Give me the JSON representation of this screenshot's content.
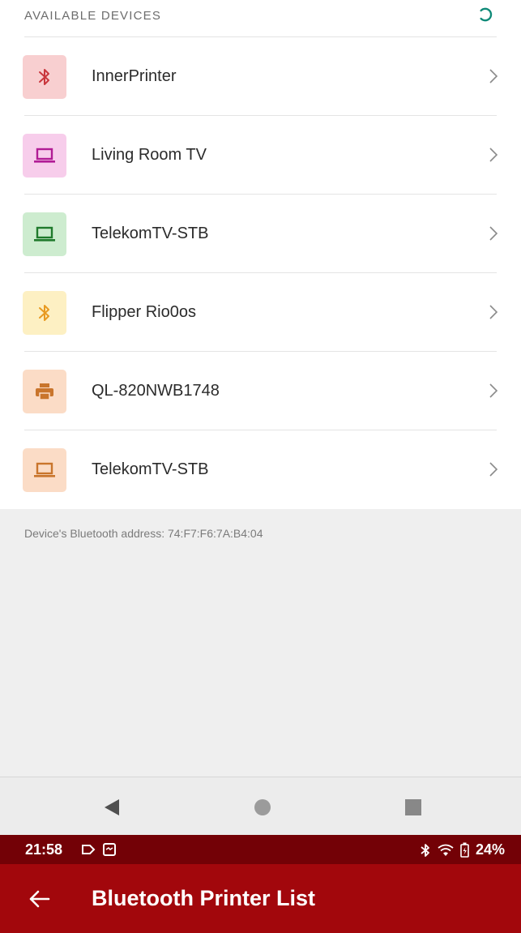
{
  "section": {
    "title": "AVAILABLE DEVICES"
  },
  "devices": [
    {
      "name": "InnerPrinter",
      "icon": "bluetooth-icon",
      "tile_color": "#f8cfd0",
      "icon_color": "#c9373d"
    },
    {
      "name": "Living Room TV",
      "icon": "laptop-icon",
      "tile_color": "#f7cdeb",
      "icon_color": "#b11c95"
    },
    {
      "name": "TelekomTV-STB",
      "icon": "laptop-icon",
      "tile_color": "#cdeccf",
      "icon_color": "#1f7a2c"
    },
    {
      "name": "Flipper Rio0os",
      "icon": "bluetooth-icon",
      "tile_color": "#fdf0c3",
      "icon_color": "#e89a21"
    },
    {
      "name": "QL-820NWB1748",
      "icon": "printer-icon",
      "tile_color": "#fbdcc6",
      "icon_color": "#c9752c"
    },
    {
      "name": "TelekomTV-STB",
      "icon": "laptop-icon",
      "tile_color": "#fbdcc6",
      "icon_color": "#c9752c"
    }
  ],
  "footer": {
    "address": "Device's Bluetooth address: 74:F7:F6:7A:B4:04"
  },
  "status_bar": {
    "time": "21:58",
    "battery": "24%"
  },
  "app_bar": {
    "title": "Bluetooth Printer List"
  },
  "colors": {
    "accent": "#a2070c",
    "status_bar": "#730106",
    "spinner": "#0f8a78"
  }
}
